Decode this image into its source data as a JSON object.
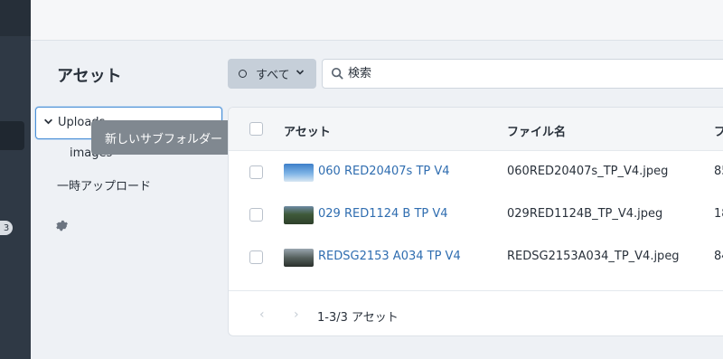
{
  "rail": {
    "badge": "3"
  },
  "page": {
    "title": "アセット"
  },
  "tree": {
    "selected_folder": "Uploads",
    "child_folder": "images",
    "temp_uploads": "一時アップロード",
    "settings_icon": "gear-icon"
  },
  "tooltip": {
    "text": "新しいサブフォルダー"
  },
  "filter": {
    "label": "すべて"
  },
  "search": {
    "placeholder": "検索"
  },
  "table": {
    "columns": [
      "アセット",
      "ファイル名",
      "フ"
    ],
    "rows": [
      {
        "name": "060 RED20407s TP V4",
        "filename": "060RED20407s_TP_V4.jpeg",
        "extra": "85"
      },
      {
        "name": "029 RED1124 B TP V4",
        "filename": "029RED1124B_TP_V4.jpeg",
        "extra": "18"
      },
      {
        "name": "REDSG2153 A034 TP V4",
        "filename": "REDSG2153A034_TP_V4.jpeg",
        "extra": "84"
      }
    ],
    "pagination": {
      "prev": "‹",
      "next": "›",
      "summary": "1-3/3 アセット"
    }
  },
  "colors": {
    "accent": "#2f6db0",
    "rail": "#2f3945",
    "filter_bg": "#c6cfd9",
    "tooltip_bg": "#808890"
  }
}
